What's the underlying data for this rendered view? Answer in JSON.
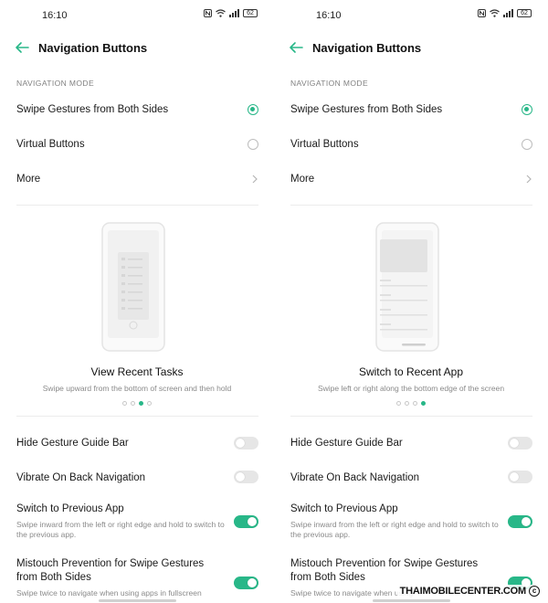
{
  "accent_color": "#28b788",
  "watermark": "THAIMOBILECENTER.COM",
  "panels": [
    {
      "status": {
        "time": "16:10",
        "battery": "62",
        "icons": [
          "nfc-icon",
          "wifi-icon",
          "signal-icon",
          "battery-icon"
        ]
      },
      "header": {
        "back_icon": "back-arrow-icon",
        "title": "Navigation Buttons"
      },
      "section_label": "NAVIGATION MODE",
      "options": [
        {
          "label": "Swipe Gestures from Both Sides",
          "selected": true
        },
        {
          "label": "Virtual Buttons",
          "selected": false
        }
      ],
      "more": {
        "label": "More",
        "icon": "chevron-right-icon"
      },
      "carousel": {
        "title": "View Recent Tasks",
        "description": "Swipe upward from the bottom of screen and then hold",
        "page_count": 4,
        "active_index": 2
      },
      "toggles": [
        {
          "label": "Hide Gesture Guide Bar",
          "description": "",
          "on": false
        },
        {
          "label": "Vibrate On Back Navigation",
          "description": "",
          "on": false
        },
        {
          "label": "Switch to Previous App",
          "description": "Swipe inward from the left or right edge and hold to switch to the previous app.",
          "on": true
        },
        {
          "label": "Mistouch Prevention for Swipe Gestures from Both Sides",
          "description": "Swipe twice to navigate when using apps in fullscreen",
          "on": true
        }
      ]
    },
    {
      "status": {
        "time": "16:10",
        "battery": "62",
        "icons": [
          "nfc-icon",
          "wifi-icon",
          "signal-icon",
          "battery-icon"
        ]
      },
      "header": {
        "back_icon": "back-arrow-icon",
        "title": "Navigation Buttons"
      },
      "section_label": "NAVIGATION MODE",
      "options": [
        {
          "label": "Swipe Gestures from Both Sides",
          "selected": true
        },
        {
          "label": "Virtual Buttons",
          "selected": false
        }
      ],
      "more": {
        "label": "More",
        "icon": "chevron-right-icon"
      },
      "carousel": {
        "title": "Switch to Recent App",
        "description": "Swipe left or right along the bottom edge of the screen",
        "page_count": 4,
        "active_index": 3
      },
      "toggles": [
        {
          "label": "Hide Gesture Guide Bar",
          "description": "",
          "on": false
        },
        {
          "label": "Vibrate On Back Navigation",
          "description": "",
          "on": false
        },
        {
          "label": "Switch to Previous App",
          "description": "Swipe inward from the left or right edge and hold to switch to the previous app.",
          "on": true
        },
        {
          "label": "Mistouch Prevention for Swipe Gestures from Both Sides",
          "description": "Swipe twice to navigate when using",
          "on": true
        }
      ]
    }
  ]
}
